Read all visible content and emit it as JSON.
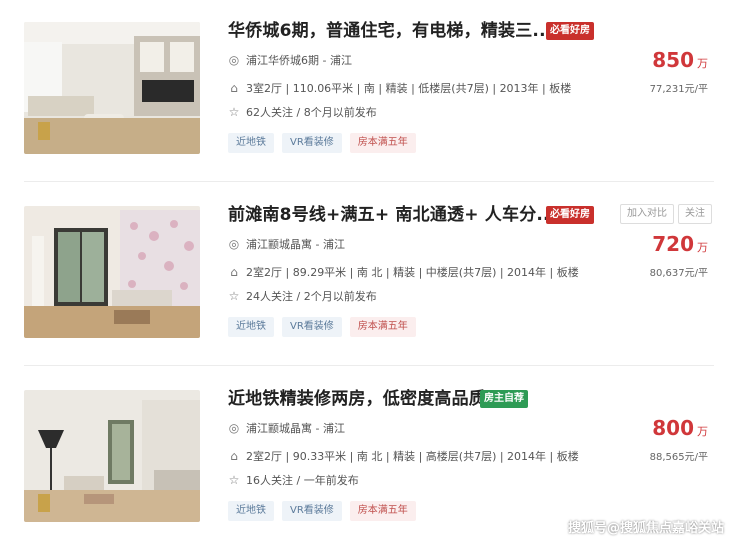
{
  "listings": [
    {
      "title": "华侨城6期，普通住宅，有电梯，精装三...",
      "tag": "必看好房",
      "tag_color": "#c9302c",
      "address": "浦江华侨城6期 - 浦江",
      "info": "3室2厅 | 110.06平米 | 南 | 精装 | 低楼层(共7层) | 2013年 | 板楼",
      "follow": "62人关注 / 8个月以前发布",
      "chips": [
        "近地铁",
        "VR看装修",
        "房本满五年"
      ],
      "price": "850",
      "price_unit": "万",
      "unit_price": "77,231元/平",
      "actions": []
    },
    {
      "title": "前滩南8号线+满五+ 南北通透+ 人车分...",
      "tag": "必看好房",
      "tag_color": "#c9302c",
      "address": "浦江颛城晶寓 - 浦江",
      "info": "2室2厅 | 89.29平米 | 南 北 | 精装 | 中楼层(共7层) | 2014年 | 板楼",
      "follow": "24人关注 / 2个月以前发布",
      "chips": [
        "近地铁",
        "VR看装修",
        "房本满五年"
      ],
      "price": "720",
      "price_unit": "万",
      "unit_price": "80,637元/平",
      "actions": [
        "加入对比",
        "关注"
      ]
    },
    {
      "title": "近地铁精装修两房，低密度高品质",
      "tag": "房主自荐",
      "tag_color": "#2e9b55",
      "address": "浦江颛城晶寓 - 浦江",
      "info": "2室2厅 | 90.33平米 | 南 北 | 精装 | 高楼层(共7层) | 2014年 | 板楼",
      "follow": "16人关注 / 一年前发布",
      "chips": [
        "近地铁",
        "VR看装修",
        "房本满五年"
      ],
      "price": "800",
      "price_unit": "万",
      "unit_price": "88,565元/平",
      "actions": []
    }
  ],
  "icons": {
    "address": "location-pin-icon",
    "info": "house-icon",
    "follow": "star-icon"
  },
  "watermark": "搜狐号@搜狐焦点嘉峪关站"
}
